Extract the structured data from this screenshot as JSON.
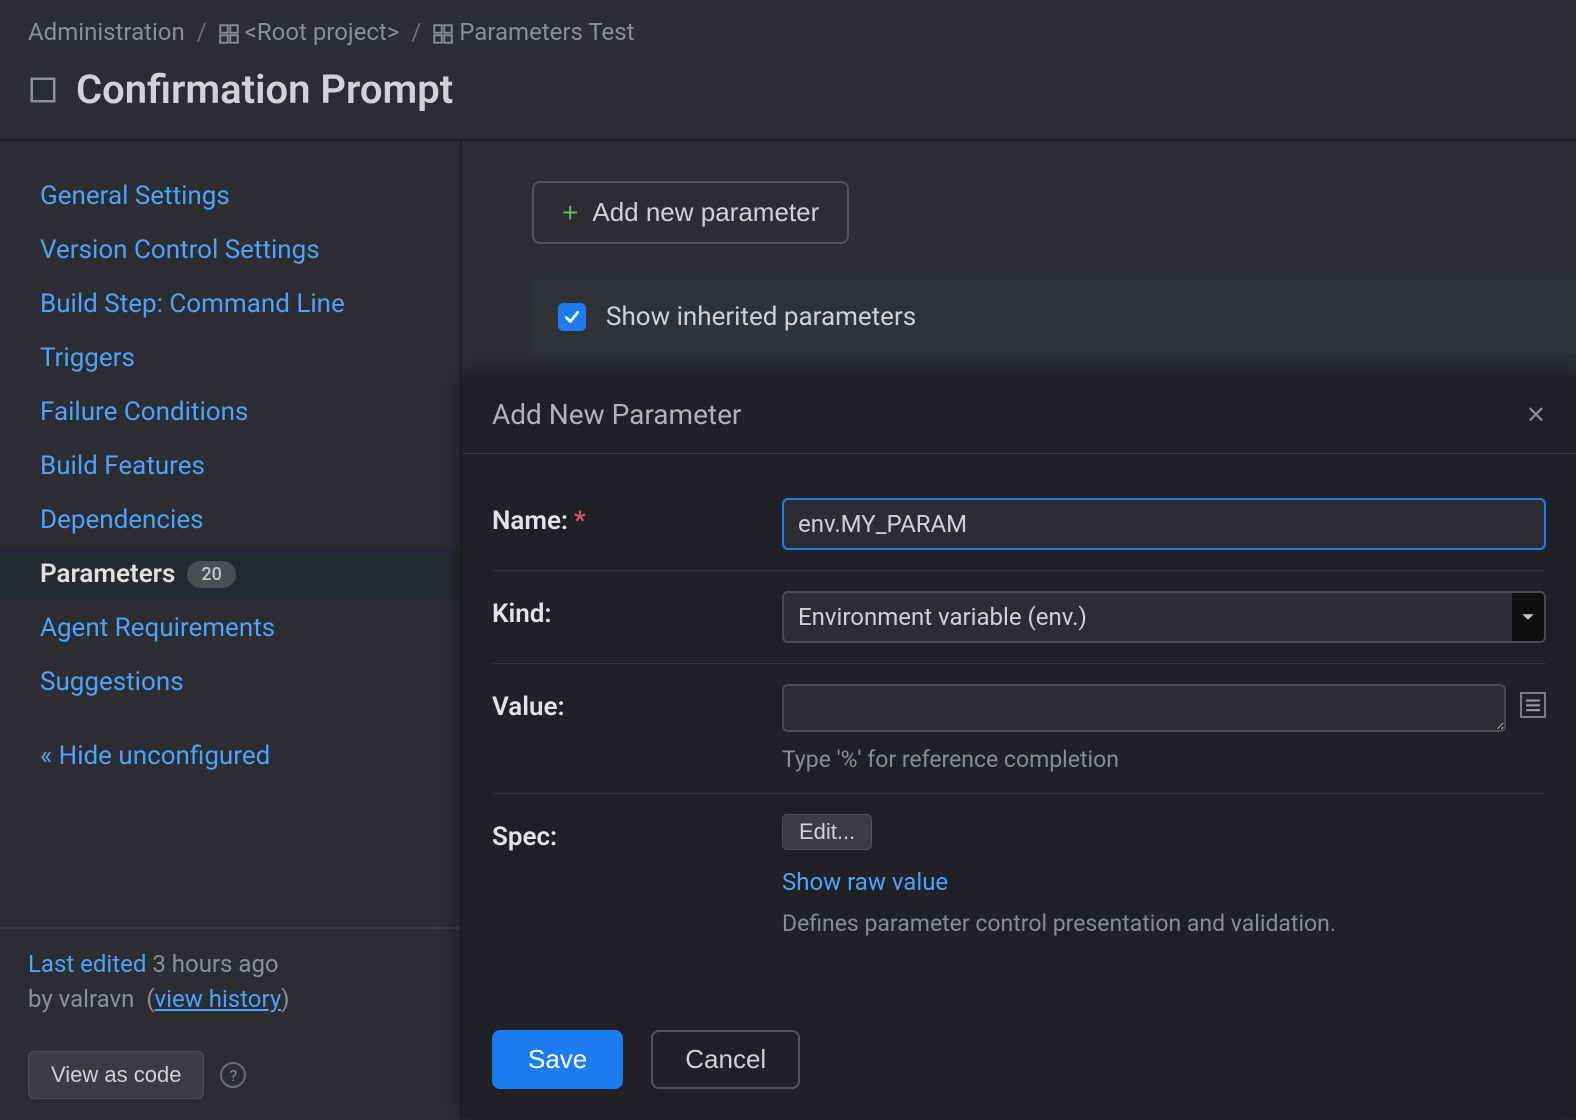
{
  "breadcrumb": {
    "admin": "Administration",
    "root": "<Root project>",
    "project": "Parameters Test"
  },
  "page_title": "Confirmation Prompt",
  "sidebar": {
    "items": [
      {
        "label": "General Settings"
      },
      {
        "label": "Version Control Settings"
      },
      {
        "label": "Build Step: Command Line"
      },
      {
        "label": "Triggers"
      },
      {
        "label": "Failure Conditions"
      },
      {
        "label": "Build Features"
      },
      {
        "label": "Dependencies"
      },
      {
        "label": "Parameters",
        "badge": "20",
        "active": true
      },
      {
        "label": "Agent Requirements"
      },
      {
        "label": "Suggestions"
      }
    ],
    "hide_unconfigured": "« Hide unconfigured",
    "last_edited_prefix": "Last edited",
    "last_edited_time": "3 hours ago",
    "last_edited_by_prefix": "by",
    "last_edited_user": "valravn",
    "view_history": "view history",
    "view_as_code": "View as code"
  },
  "content": {
    "add_param_button": "Add new parameter",
    "show_inherited": "Show inherited parameters"
  },
  "dialog": {
    "title": "Add New Parameter",
    "labels": {
      "name": "Name:",
      "kind": "Kind:",
      "value": "Value:",
      "spec": "Spec:"
    },
    "fields": {
      "name_value": "env.MY_PARAM",
      "kind_value": "Environment variable (env.)",
      "value_value": "",
      "value_hint": "Type '%' for reference completion",
      "spec_edit": "Edit...",
      "spec_show_raw": "Show raw value",
      "spec_desc": "Defines parameter control presentation and validation."
    },
    "buttons": {
      "save": "Save",
      "cancel": "Cancel"
    }
  }
}
